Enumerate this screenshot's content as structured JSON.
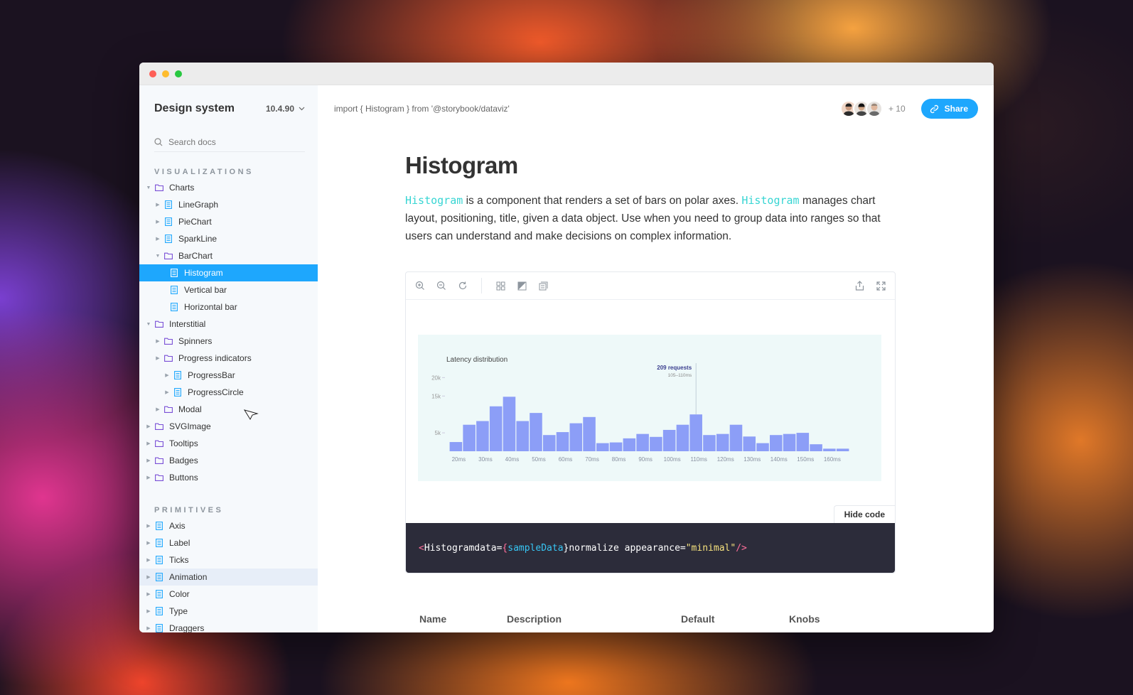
{
  "sidebar": {
    "brand": "Design system",
    "version": "10.4.90",
    "search_placeholder": "Search docs",
    "sections": [
      {
        "title": "VISUALIZATIONS",
        "items": [
          {
            "label": "Charts",
            "type": "folder",
            "depth": 0,
            "expanded": true
          },
          {
            "label": "LineGraph",
            "type": "doc",
            "depth": 1,
            "expanded": false
          },
          {
            "label": "PieChart",
            "type": "doc",
            "depth": 1,
            "expanded": false
          },
          {
            "label": "SparkLine",
            "type": "doc",
            "depth": 1,
            "expanded": false
          },
          {
            "label": "BarChart",
            "type": "folder",
            "depth": 1,
            "expanded": true
          },
          {
            "label": "Histogram",
            "type": "doc",
            "depth": 2,
            "active": true
          },
          {
            "label": "Vertical bar",
            "type": "doc",
            "depth": 2
          },
          {
            "label": "Horizontal bar",
            "type": "doc",
            "depth": 2
          },
          {
            "label": "Interstitial",
            "type": "folder",
            "depth": 0,
            "expanded": true
          },
          {
            "label": "Spinners",
            "type": "folder",
            "depth": 1,
            "expanded": false
          },
          {
            "label": "Progress indicators",
            "type": "folder",
            "depth": 1,
            "expanded": false
          },
          {
            "label": "ProgressBar",
            "type": "doc",
            "depth": 2,
            "expanded": false,
            "caret": true
          },
          {
            "label": "ProgressCircle",
            "type": "doc",
            "depth": 2,
            "expanded": false,
            "caret": true
          },
          {
            "label": "Modal",
            "type": "folder",
            "depth": 1,
            "expanded": false
          },
          {
            "label": "SVGImage",
            "type": "folder",
            "depth": 0,
            "expanded": false
          },
          {
            "label": "Tooltips",
            "type": "folder",
            "depth": 0,
            "expanded": false
          },
          {
            "label": "Badges",
            "type": "folder",
            "depth": 0,
            "expanded": false
          },
          {
            "label": "Buttons",
            "type": "folder",
            "depth": 0,
            "expanded": false
          }
        ]
      },
      {
        "title": "PRIMITIVES",
        "items": [
          {
            "label": "Axis",
            "type": "doc",
            "depth": 0
          },
          {
            "label": "Label",
            "type": "doc",
            "depth": 0
          },
          {
            "label": "Ticks",
            "type": "doc",
            "depth": 0
          },
          {
            "label": "Animation",
            "type": "doc",
            "depth": 0,
            "hover": true
          },
          {
            "label": "Color",
            "type": "doc",
            "depth": 0
          },
          {
            "label": "Type",
            "type": "doc",
            "depth": 0
          },
          {
            "label": "Draggers",
            "type": "doc",
            "depth": 0
          }
        ]
      }
    ]
  },
  "topbar": {
    "import_text": "import { Histogram } from '@storybook/dataviz'",
    "more_count": "+ 10",
    "share_label": "Share"
  },
  "doc": {
    "title": "Histogram",
    "desc_code_1": "Histogram",
    "desc_text_1": " is a component that renders a set of bars on polar axes. ",
    "desc_code_2": "Histogram",
    "desc_text_2": " manages chart layout, positioning, title, given a data object. Use when you need to group data into ranges so that users can understand and make decisions on complex information.",
    "hide_code_label": "Hide code",
    "code": {
      "open": "<",
      "tag": "Histogram",
      "attr1": " data=",
      "brace_open": "{",
      "var": "sampleData",
      "brace_close": "}",
      "attr2": " normalize appearance=",
      "str": "\"minimal\"",
      "close": " />"
    },
    "props_headers": [
      "Name",
      "Description",
      "Default",
      "Knobs"
    ]
  },
  "colors": {
    "accent": "#1ea7fd",
    "bar": "#8c9ef7",
    "folder_icon": "#7a4fd6",
    "doc_icon": "#1ea7fd"
  },
  "chart_data": {
    "type": "bar",
    "title": "Latency distribution",
    "x_tick_labels": [
      "20ms",
      "30ms",
      "40ms",
      "50ms",
      "60ms",
      "70ms",
      "80ms",
      "90ms",
      "100ms",
      "110ms",
      "120ms",
      "130ms",
      "140ms",
      "150ms",
      "160ms"
    ],
    "y_tick_labels": [
      "5k",
      "15k",
      "20k"
    ],
    "values": [
      2500,
      7200,
      8200,
      12200,
      14800,
      8200,
      10400,
      4400,
      5200,
      7600,
      9300,
      2200,
      2400,
      3500,
      4700,
      3900,
      5800,
      7200,
      10000,
      4400,
      4700,
      7200,
      4000,
      2200,
      4400,
      4700,
      5000,
      1900,
      700,
      700
    ],
    "ylim": [
      0,
      22000
    ],
    "highlight": {
      "label": "209 requests",
      "sublabel": "105–110ms"
    }
  }
}
